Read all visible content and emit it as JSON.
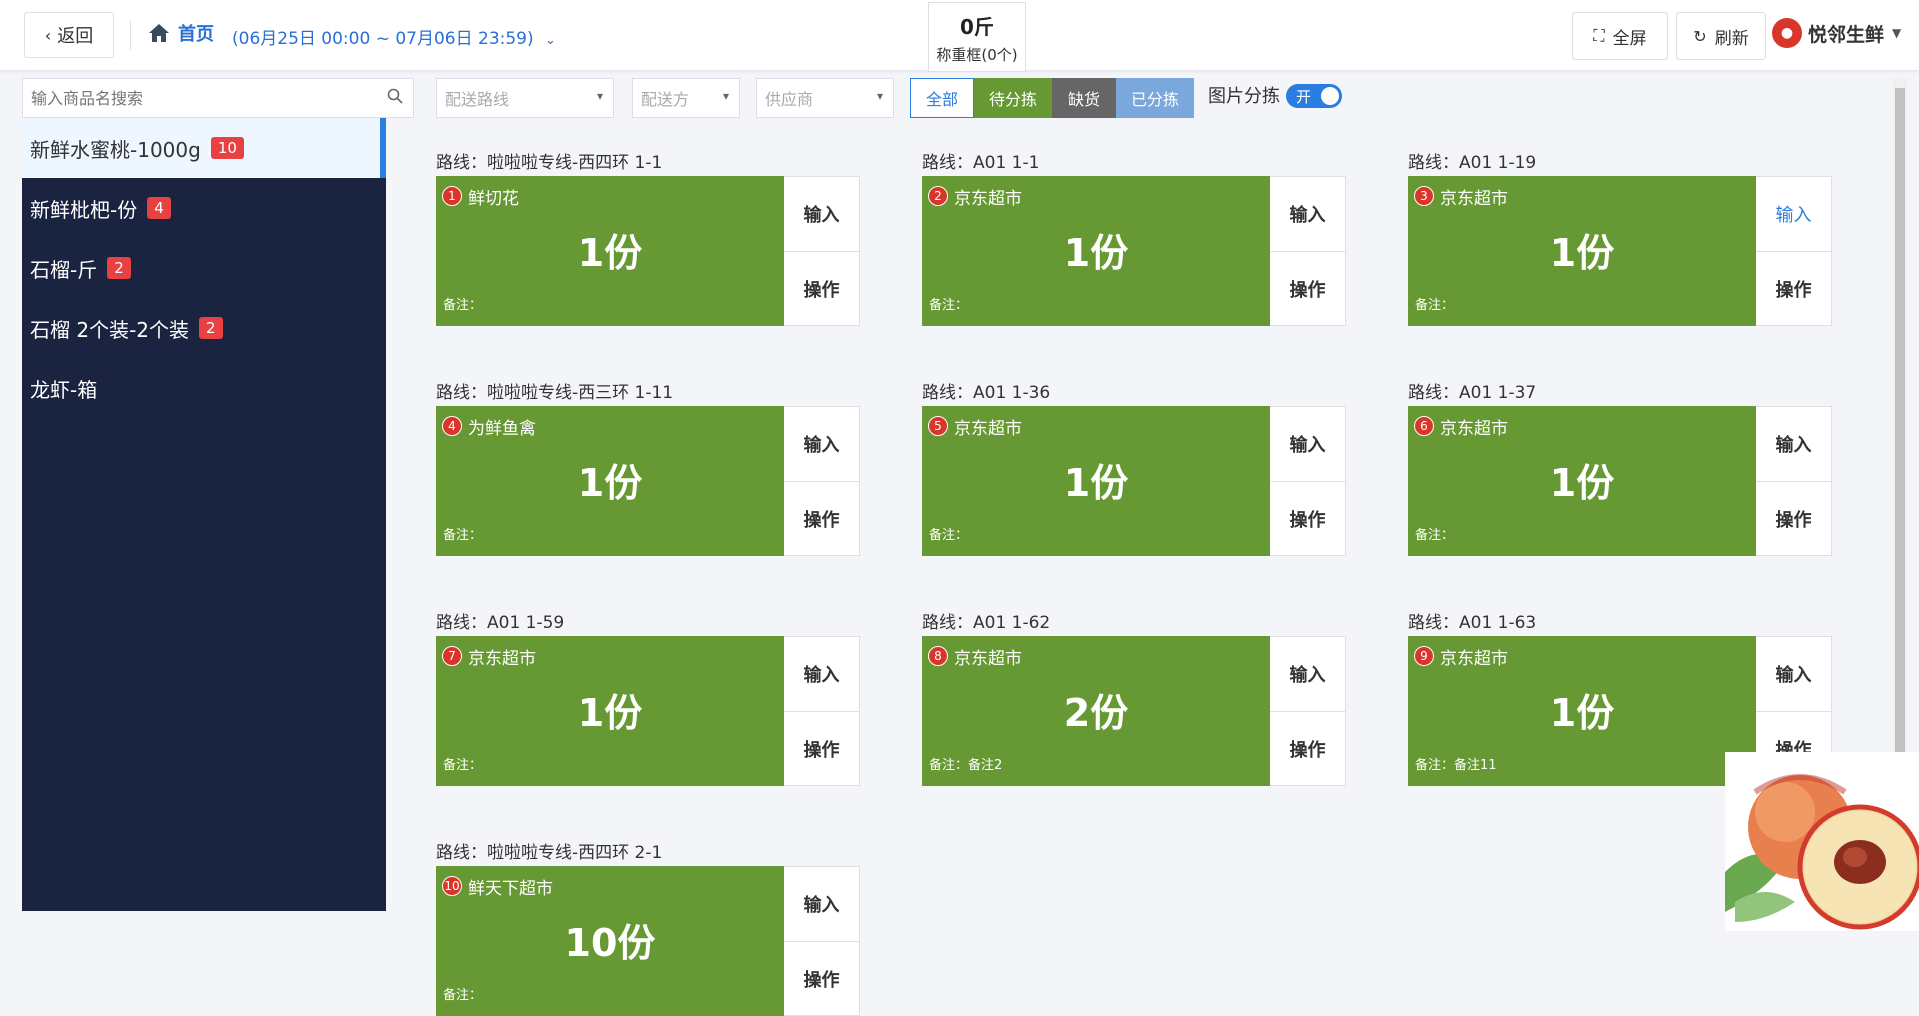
{
  "header": {
    "back_label": "返回",
    "home_label": "首页",
    "date_range": "(06月25日 00:00 ~ 07月06日 23:59)",
    "weight_value": "0斤",
    "weight_box_label": "称重框(0个)",
    "fullscreen_label": "全屏",
    "refresh_label": "刷新",
    "brand_name": "悦邻生鲜",
    "accent_color": "#2a6fd6"
  },
  "search": {
    "placeholder": "输入商品名搜索"
  },
  "sidebar": {
    "items": [
      {
        "label": "新鲜水蜜桃-1000g",
        "badge": "10",
        "active": true
      },
      {
        "label": "新鲜枇杷-份",
        "badge": "4"
      },
      {
        "label": "石榴-斤",
        "badge": "2"
      },
      {
        "label": "石榴 2个装-2个装",
        "badge": "2"
      },
      {
        "label": "龙虾-箱",
        "badge": ""
      }
    ]
  },
  "filters": {
    "route_placeholder": "配送路线",
    "delivery_placeholder": "配送方",
    "supplier_placeholder": "供应商",
    "tabs": [
      "全部",
      "待分拣",
      "缺货",
      "已分拣"
    ],
    "image_sort_label": "图片分拣",
    "toggle_text": "开"
  },
  "card_labels": {
    "route_prefix": "路线：",
    "input": "输入",
    "operate": "操作",
    "note_prefix": "备注："
  },
  "cards": [
    {
      "route": "啦啦啦专线-西四环 1-1",
      "num": "1",
      "customer": "鲜切花",
      "qty": "1份",
      "note": ""
    },
    {
      "route": "A01 1-1",
      "num": "2",
      "customer": "京东超市",
      "qty": "1份",
      "note": ""
    },
    {
      "route": "A01 1-19",
      "num": "3",
      "customer": "京东超市",
      "qty": "1份",
      "note": ""
    },
    {
      "route": "啦啦啦专线-西三环 1-11",
      "num": "4",
      "customer": "为鲜鱼禽",
      "qty": "1份",
      "note": ""
    },
    {
      "route": "A01 1-36",
      "num": "5",
      "customer": "京东超市",
      "qty": "1份",
      "note": ""
    },
    {
      "route": "A01 1-37",
      "num": "6",
      "customer": "京东超市",
      "qty": "1份",
      "note": ""
    },
    {
      "route": "A01 1-59",
      "num": "7",
      "customer": "京东超市",
      "qty": "1份",
      "note": ""
    },
    {
      "route": "A01 1-62",
      "num": "8",
      "customer": "京东超市",
      "qty": "2份",
      "note": "备注2"
    },
    {
      "route": "A01 1-63",
      "num": "9",
      "customer": "京东超市",
      "qty": "1份",
      "note": "备注11"
    },
    {
      "route": "啦啦啦专线-西四环 2-1",
      "num": "10",
      "customer": "鲜天下超市",
      "qty": "10份",
      "note": ""
    }
  ]
}
